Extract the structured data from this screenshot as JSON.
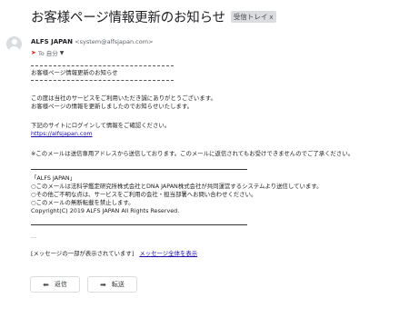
{
  "message": {
    "subject": "お客様ページ情報更新のお知らせ",
    "label": "受信トレイ",
    "label_close": "x",
    "sender_name": "ALFS JAPAN",
    "sender_email": "<system@alfsjapan.com>",
    "to_label": "To 自分",
    "importance_icon": "important-marker-icon"
  },
  "body": {
    "heading": "お客様ページ情報更新のお知らせ",
    "line1": "この度は当社のサービスをご利用いただき誠にありがとうございます。",
    "line2": "お客様ページの情報を更新しましたのでお知らせいたします。",
    "line3": "下記のサイトにログインして情報をご確認ください。",
    "site_link": "https://alfsjapan.com",
    "notice": "※このメールは送信専用アドレスから送信しております。このメールに返信されてもお受けできませんのでご了承ください。",
    "footer": [
      "「ALFS JAPAN」",
      "○このメールは法科学鑑定研究所株式会社とDNA JAPAN株式会社が共同運営するシステムより送信しています。",
      "○その他ご不明な点は、サービスをご利用の会社・担当部署へお問い合わせください。",
      "○このメールの無断転載を禁止します。",
      "Copyright(C) 2019 ALFS JAPAN All Rights Reserved."
    ],
    "ellipsis": "...",
    "clipped_text": "[メッセージの一部が表示されています]",
    "show_full_link": "メッセージ全体を表示"
  },
  "actions": {
    "reply_label": "返信",
    "forward_label": "転送"
  },
  "colors": {
    "link": "#1a0dab",
    "importance": "#d93025",
    "chip_bg": "#dadce0"
  }
}
